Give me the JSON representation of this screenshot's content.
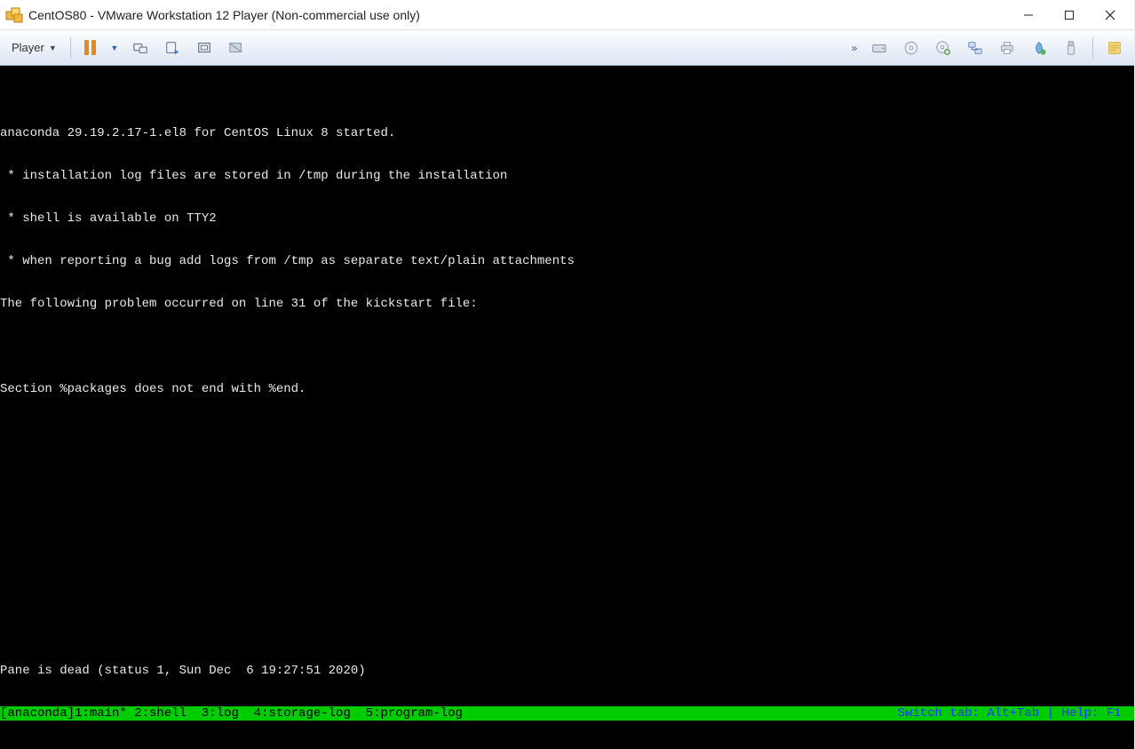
{
  "window": {
    "title": "CentOS80 - VMware Workstation 12 Player (Non-commercial use only)"
  },
  "toolbar": {
    "player_label": "Player"
  },
  "console_output": {
    "l1": "anaconda 29.19.2.17-1.el8 for CentOS Linux 8 started.",
    "l2": " * installation log files are stored in /tmp during the installation",
    "l3": " * shell is available on TTY2",
    "l4": " * when reporting a bug add logs from /tmp as separate text/plain attachments",
    "l5": "The following problem occurred on line 31 of the kickstart file:",
    "l6": "",
    "l7": "Section %packages does not end with %end."
  },
  "pane_status": "Pane is dead (status 1, Sun Dec  6 19:27:51 2020)",
  "statusbar": {
    "left": "[anaconda]1:main* 2:shell  3:log  4:storage-log  5:program-log",
    "right": "Switch tab: Alt+Tab | Help: F1 "
  }
}
